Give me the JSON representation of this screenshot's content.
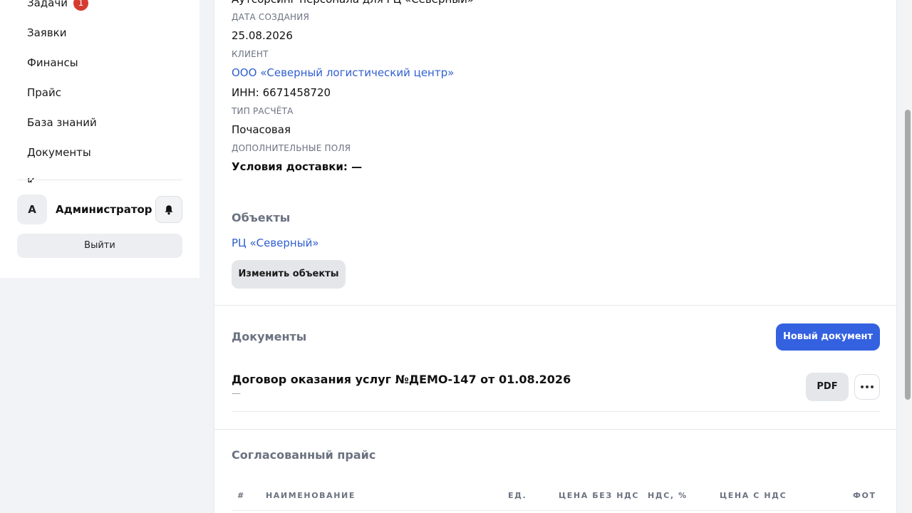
{
  "sidebar": {
    "items": [
      {
        "label": "Задачи",
        "badge": "1"
      },
      {
        "label": "Заявки"
      },
      {
        "label": "Финансы"
      },
      {
        "label": "Прайс"
      },
      {
        "label": "База знаний"
      },
      {
        "label": "Документы"
      },
      {
        "label": "К"
      }
    ],
    "user": {
      "avatar_letter": "А",
      "name": "Администратор"
    },
    "logout_label": "Выйти"
  },
  "order": {
    "title": "Аутсорсинг персонала для РЦ «Северный»",
    "created_label": "ДАТА СОЗДАНИЯ",
    "created_value": "25.08.2026",
    "client_label": "КЛИЕНТ",
    "client_name": "ООО «Северный логистический центр»",
    "client_inn": "ИНН: 6671458720",
    "payment_type_label": "ТИП РАСЧЁТА",
    "payment_type_value": "Почасовая",
    "extra_fields_label": "ДОПОЛНИТЕЛЬНЫЕ ПОЛЯ",
    "extra_fields_value": "Условия доставки: —"
  },
  "objects": {
    "title": "Объекты",
    "items": [
      "РЦ «Северный»"
    ],
    "edit_label": "Изменить объекты"
  },
  "documents": {
    "title": "Документы",
    "new_label": "Новый документ",
    "items": [
      {
        "title": "Договор оказания услуг №ДЕМО-147 от 01.08.2026",
        "subtitle": "—",
        "pdf_label": "PDF"
      }
    ]
  },
  "price": {
    "title": "Согласованный прайс",
    "columns": [
      "#",
      "НАИМЕНОВАНИЕ",
      "ЕД.",
      "ЦЕНА БЕЗ НДС",
      "НДС, %",
      "ЦЕНА С НДС",
      "ФОТ"
    ]
  },
  "colors": {
    "accent": "#3461e0",
    "link": "#2f5fd0",
    "badge": "#d63b2f"
  }
}
